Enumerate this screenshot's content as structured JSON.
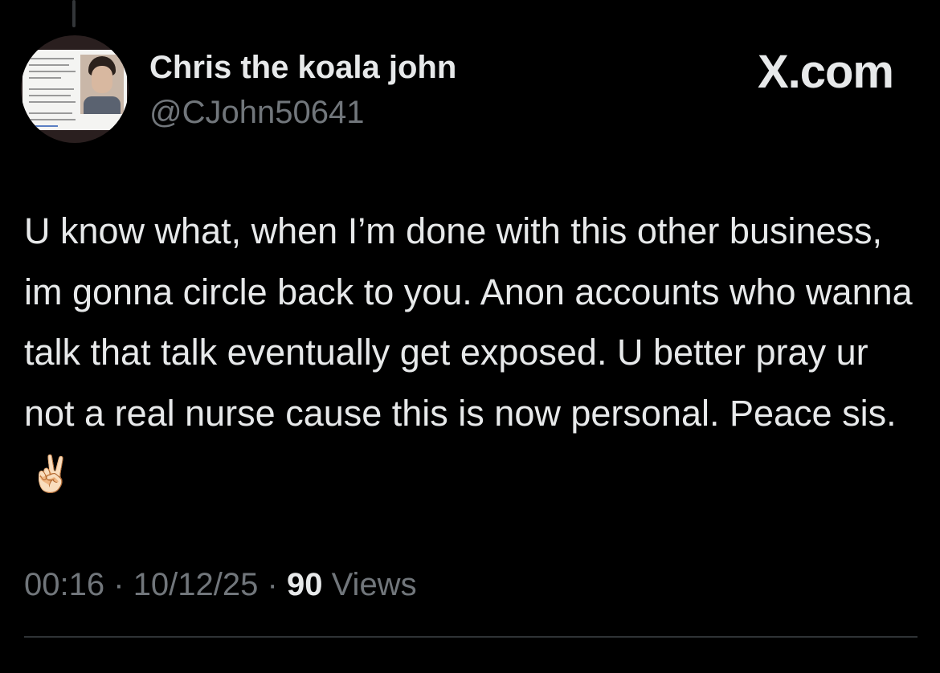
{
  "author": {
    "display_name": "Chris the koala john",
    "handle": "@CJohn50641"
  },
  "brand": {
    "label": "X.com"
  },
  "tweet": {
    "text": "U know what, when I’m done with this other business, im gonna circle back to you. Anon accounts who wanna talk that talk eventually get exposed. U better pray ur not a real nurse cause this is now personal. Peace sis.",
    "emoji": "✌🏻"
  },
  "meta": {
    "time": "00:16",
    "separator": "·",
    "date": "10/12/25",
    "views_count": "90",
    "views_label": "Views"
  },
  "colors": {
    "background": "#000000",
    "primary_text": "#e7e9ea",
    "secondary_text": "#71767b",
    "divider": "#2f3336"
  },
  "icons": {
    "avatar": "profile-photo",
    "emoji": "victory-hand"
  }
}
